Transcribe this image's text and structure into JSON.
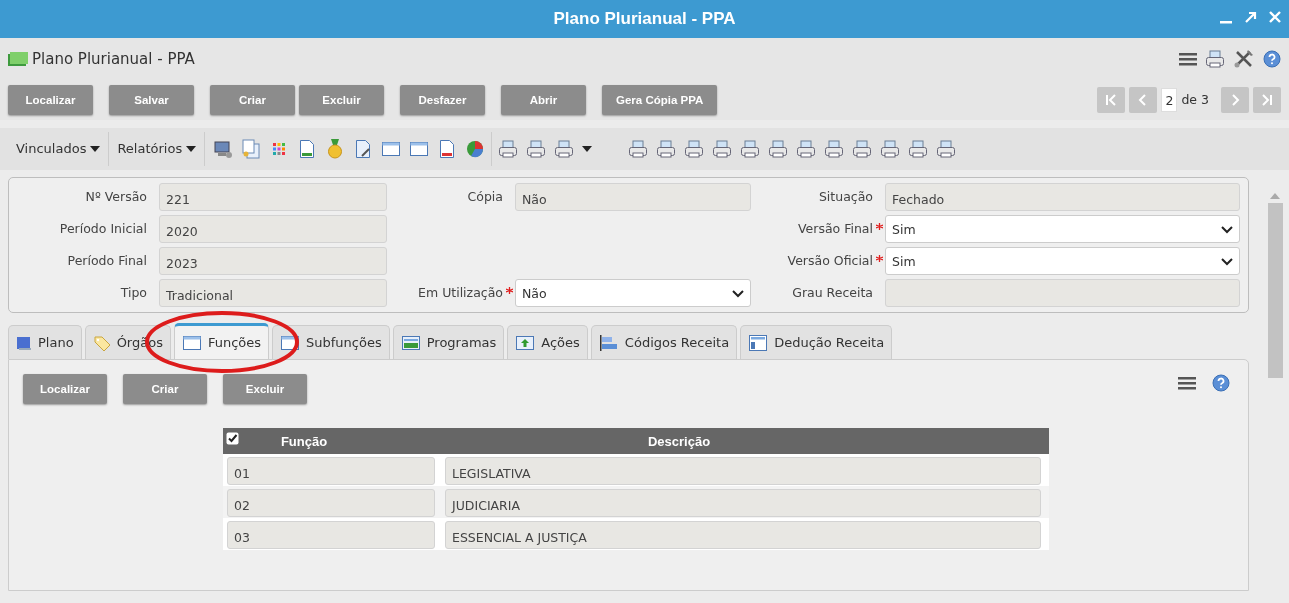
{
  "window": {
    "title": "Plano Plurianual - PPA"
  },
  "header": {
    "title": "Plano Plurianual - PPA"
  },
  "toolbar": {
    "button_groups": [
      [
        "Localizar"
      ],
      [
        "Salvar"
      ],
      [
        "Criar",
        "Excluir"
      ],
      [
        "Desfazer"
      ],
      [
        "Abrir"
      ],
      [
        "Gera Cópia PPA"
      ]
    ],
    "pager": {
      "current": "2",
      "total_text": "de 3"
    }
  },
  "menus": [
    {
      "label": "Vinculados"
    },
    {
      "label": "Relatórios"
    }
  ],
  "form": {
    "rows": [
      {
        "left": {
          "label": "Nº Versão",
          "value": "221",
          "kind": "readonly",
          "required": false
        },
        "middle": {
          "label": "Cópia",
          "value": "Não",
          "kind": "readonly",
          "required": false
        },
        "right": {
          "label": "Situação",
          "value": "Fechado",
          "kind": "readonly",
          "required": false
        }
      },
      {
        "left": {
          "label": "Período Inicial",
          "value": "2020",
          "kind": "readonly",
          "required": false
        },
        "right": {
          "label": "Versão Final",
          "value": "Sim",
          "kind": "select",
          "required": true
        }
      },
      {
        "left": {
          "label": "Período Final",
          "value": "2023",
          "kind": "readonly",
          "required": false
        },
        "right": {
          "label": "Versão Oficial",
          "value": "Sim",
          "kind": "select",
          "required": true
        }
      },
      {
        "left": {
          "label": "Tipo",
          "value": "Tradicional",
          "kind": "readonly",
          "required": false
        },
        "middle": {
          "label": "Em Utilização",
          "value": "Não",
          "kind": "select",
          "required": true
        },
        "right": {
          "label": "Grau Receita",
          "kind": "readonly",
          "required": false
        }
      }
    ]
  },
  "tabs": [
    {
      "label": "Plano",
      "selected": false
    },
    {
      "label": "Órgãos",
      "selected": false
    },
    {
      "label": "Funções",
      "selected": true
    },
    {
      "label": "Subfunções",
      "selected": false
    },
    {
      "label": "Programas",
      "selected": false
    },
    {
      "label": "Ações",
      "selected": false
    },
    {
      "label": "Códigos Receita",
      "selected": false
    },
    {
      "label": "Dedução Receita",
      "selected": false
    }
  ],
  "tab_panel": {
    "buttons": [
      "Localizar",
      "Criar",
      "Excluir"
    ],
    "table": {
      "select_all_checked": true,
      "columns": [
        "Função",
        "Descrição"
      ],
      "rows": [
        {
          "funcao": "01",
          "descricao": "LEGISLATIVA"
        },
        {
          "funcao": "02",
          "descricao": "JUDICIARIA"
        },
        {
          "funcao": "03",
          "descricao": "ESSENCIAL A JUSTIÇA"
        }
      ]
    }
  }
}
